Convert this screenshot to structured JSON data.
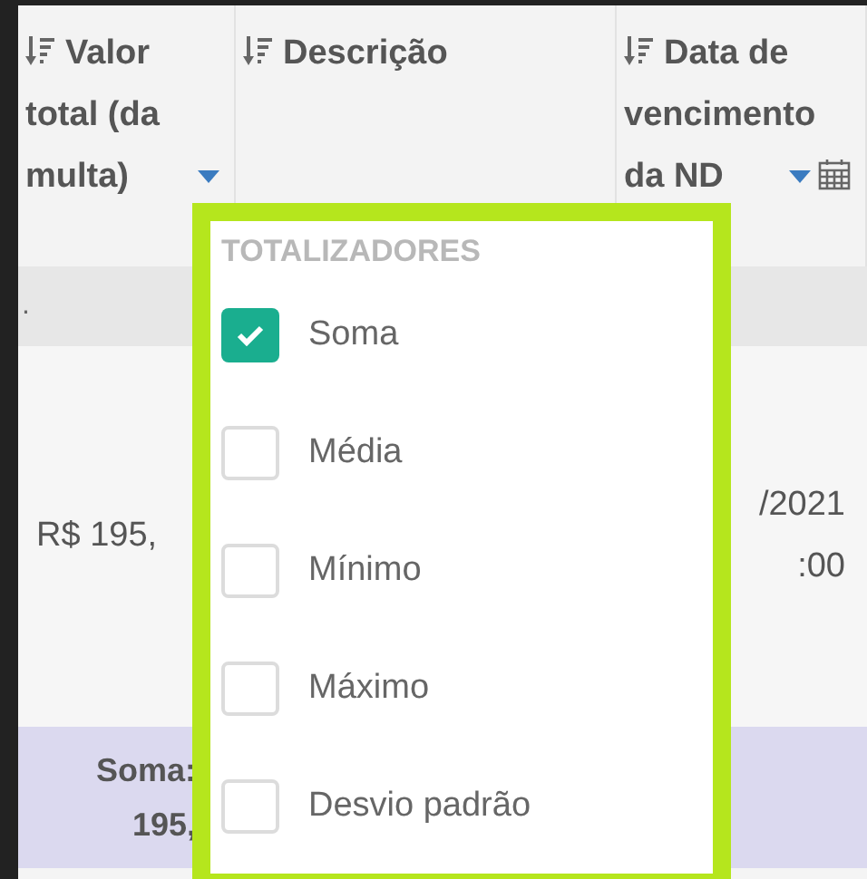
{
  "columns": [
    {
      "label": "Valor total (da multa)",
      "sortable": true,
      "filter": true,
      "calendar": false
    },
    {
      "label": "Descrição",
      "sortable": true,
      "filter": false,
      "calendar": false
    },
    {
      "label": "Data de vencimento da ND",
      "sortable": true,
      "filter": true,
      "calendar": true
    }
  ],
  "group_row": {
    "text": "."
  },
  "data_row": {
    "cells": [
      [
        "R$ 195,"
      ],
      [],
      [
        "/2021",
        ":00"
      ]
    ]
  },
  "summary_row": {
    "cells": [
      [
        "Soma:",
        "195,"
      ],
      [],
      []
    ]
  },
  "totals_menu": {
    "title": "TOTALIZADORES",
    "options": [
      {
        "label": "Soma",
        "checked": true
      },
      {
        "label": "Média",
        "checked": false
      },
      {
        "label": "Mínimo",
        "checked": false
      },
      {
        "label": "Máximo",
        "checked": false
      },
      {
        "label": "Desvio padrão",
        "checked": false
      }
    ]
  }
}
